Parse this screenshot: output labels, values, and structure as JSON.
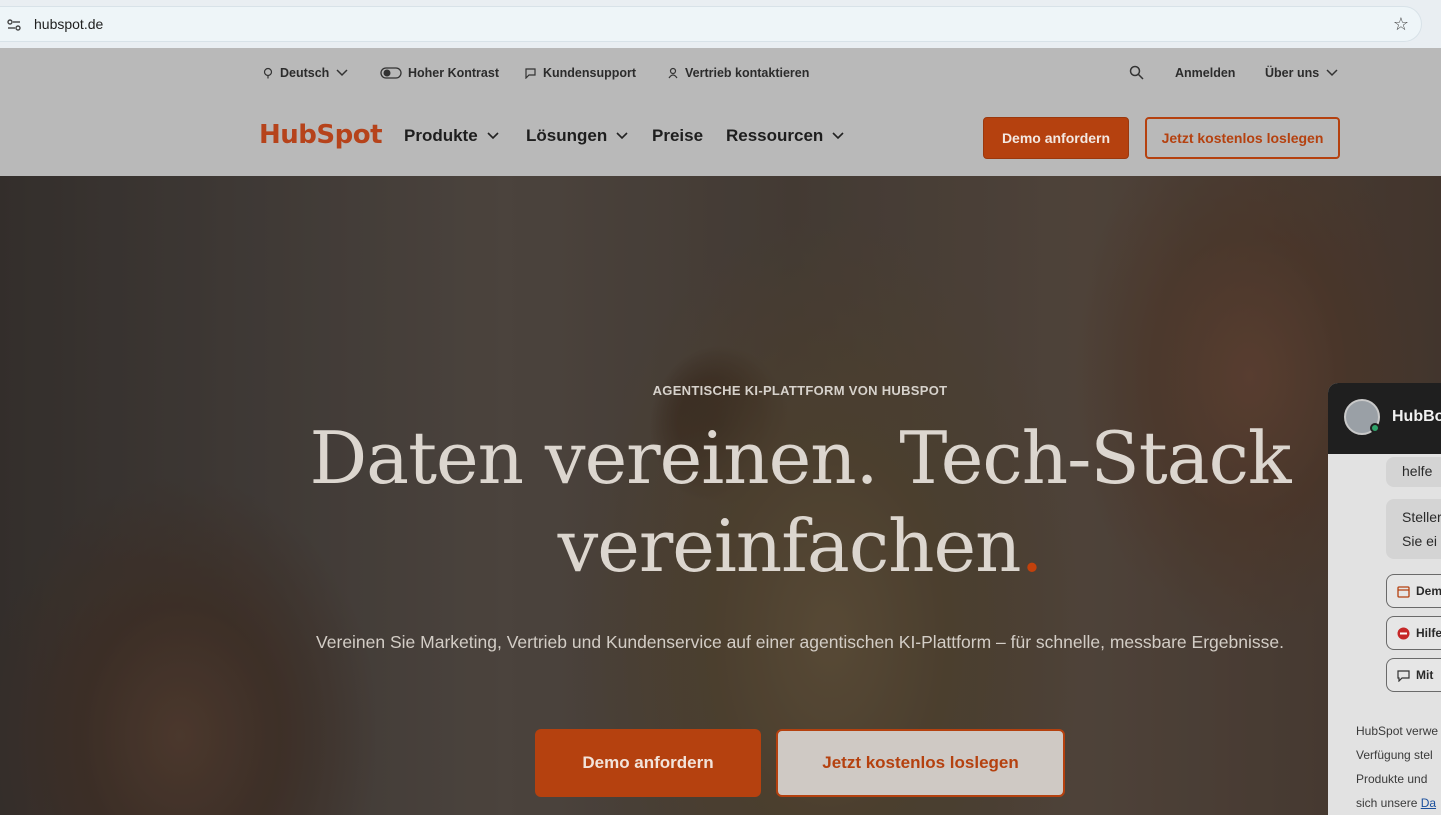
{
  "browser": {
    "url": "hubspot.de"
  },
  "utility_nav": {
    "language": "Deutsch",
    "contrast": "Hoher Kontrast",
    "support": "Kundensupport",
    "sales": "Vertrieb kontaktieren",
    "login": "Anmelden",
    "about": "Über uns"
  },
  "main_nav": {
    "logo": "HubSpot",
    "items": [
      {
        "label": "Produkte"
      },
      {
        "label": "Lösungen"
      },
      {
        "label": "Preise"
      },
      {
        "label": "Ressourcen"
      }
    ],
    "demo_button": "Demo anfordern",
    "free_button": "Jetzt kostenlos loslegen"
  },
  "hero": {
    "eyebrow": "AGENTISCHE KI-PLATTFORM VON HUBSPOT",
    "headline_line1": "Daten vereinen. Tech-Stack",
    "headline_line2": "vereinfachen",
    "headline_dot": ".",
    "subtitle": "Vereinen Sie Marketing, Vertrieb und Kundenservice auf einer agentischen KI-Plattform – für schnelle, messbare Ergebnisse.",
    "demo_button": "Demo anfordern",
    "free_button": "Jetzt kostenlos loslegen"
  },
  "chat": {
    "title": "HubBo",
    "message1": "helfe",
    "message2_line1": "Steller",
    "message2_line2": "Sie ei",
    "options": [
      "Dem",
      "Hilfe",
      "Mit"
    ],
    "footer_line1": "HubSpot verwe",
    "footer_line2": "Verfügung stel",
    "footer_line3": "Produkte und",
    "footer_line4_prefix": "sich unsere ",
    "footer_link": "Da"
  },
  "colors": {
    "brand_orange": "#b5410f",
    "header_bg": "#b9b9b9"
  }
}
